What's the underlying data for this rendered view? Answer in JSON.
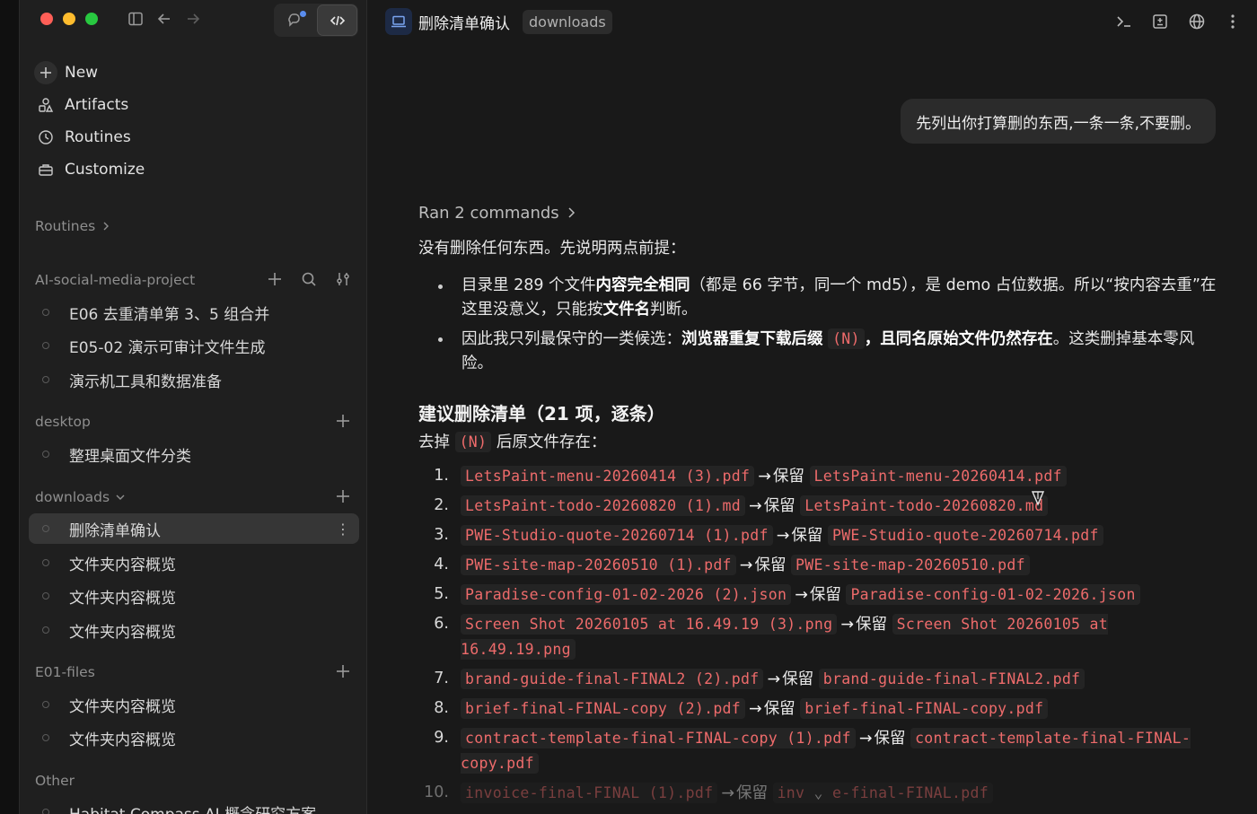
{
  "sidebar": {
    "nav": [
      {
        "label": "New",
        "icon": "plus-icon"
      },
      {
        "label": "Artifacts",
        "icon": "shapes-icon"
      },
      {
        "label": "Routines",
        "icon": "clock-icon"
      },
      {
        "label": "Customize",
        "icon": "briefcase-icon"
      }
    ],
    "routines_header": "Routines",
    "sections": {
      "project": {
        "title": "AI-social-media-project",
        "threads": [
          "E06 去重清单第 3、5 组合并",
          "E05-02 演示可审计文件生成",
          "演示机工具和数据准备"
        ]
      },
      "desktop": {
        "title": "desktop",
        "threads": [
          "整理桌面文件分类"
        ]
      },
      "downloads": {
        "title": "downloads",
        "threads": [
          "删除清单确认",
          "文件夹内容概览",
          "文件夹内容概览",
          "文件夹内容概览"
        ]
      },
      "e01": {
        "title": "E01-files",
        "threads": [
          "文件夹内容概览",
          "文件夹内容概览"
        ]
      },
      "other": {
        "title": "Other",
        "threads": [
          "Habitat Compass AI 概念研究方案"
        ]
      }
    }
  },
  "header": {
    "title": "删除清单确认",
    "badge": "downloads"
  },
  "chat": {
    "user_message": "先列出你打算删的东西,一条一条,不要删。",
    "ran_commands": "Ran 2 commands",
    "intro": "没有删除任何东西。先说明两点前提：",
    "bullet1": {
      "a": "目录里 289 个文件",
      "b": "内容完全相同",
      "c": "（都是 66 字节，同一个 md5），是 demo 占位数据。所以“按内容去重”在这里没意义，只能按",
      "d": "文件名",
      "e": "判断。"
    },
    "bullet2": {
      "a": "因此我只列最保守的一类候选：",
      "b": "浏览器重复下载后缀",
      "code": "(N)",
      "c": "，且同名原始文件仍然存在",
      "d": "。这类删掉基本零风险。"
    },
    "heading": "建议删除清单（21 项，逐条）",
    "lead": {
      "a": "去掉",
      "code": "(N)",
      "b": "后原文件存在："
    },
    "keep_label": "保留",
    "arrow": "→",
    "files": [
      {
        "n": "1.",
        "del": "LetsPaint-menu-20260414 (3).pdf",
        "keep": "LetsPaint-menu-20260414.pdf"
      },
      {
        "n": "2.",
        "del": "LetsPaint-todo-20260820 (1).md",
        "keep": "LetsPaint-todo-20260820.md"
      },
      {
        "n": "3.",
        "del": "PWE-Studio-quote-20260714 (1).pdf",
        "keep": "PWE-Studio-quote-20260714.pdf"
      },
      {
        "n": "4.",
        "del": "PWE-site-map-20260510 (1).pdf",
        "keep": "PWE-site-map-20260510.pdf"
      },
      {
        "n": "5.",
        "del": "Paradise-config-01-02-2026 (2).json",
        "keep": "Paradise-config-01-02-2026.json"
      },
      {
        "n": "6.",
        "del": "Screen Shot 20260105 at 16.49.19 (3).png",
        "keep": "Screen Shot 20260105 at 16.49.19.png"
      },
      {
        "n": "7.",
        "del": "brand-guide-final-FINAL2 (2).pdf",
        "keep": "brand-guide-final-FINAL2.pdf"
      },
      {
        "n": "8.",
        "del": "brief-final-FINAL-copy (2).pdf",
        "keep": "brief-final-FINAL-copy.pdf"
      },
      {
        "n": "9.",
        "del": "contract-template-final-FINAL-copy (1).pdf",
        "keep": "contract-template-final-FINAL-copy.pdf"
      },
      {
        "n": "10.",
        "del": "invoice-final-FINAL (1).pdf",
        "keep": "inv",
        "keep_tail": "e-final-FINAL.pdf"
      }
    ]
  }
}
